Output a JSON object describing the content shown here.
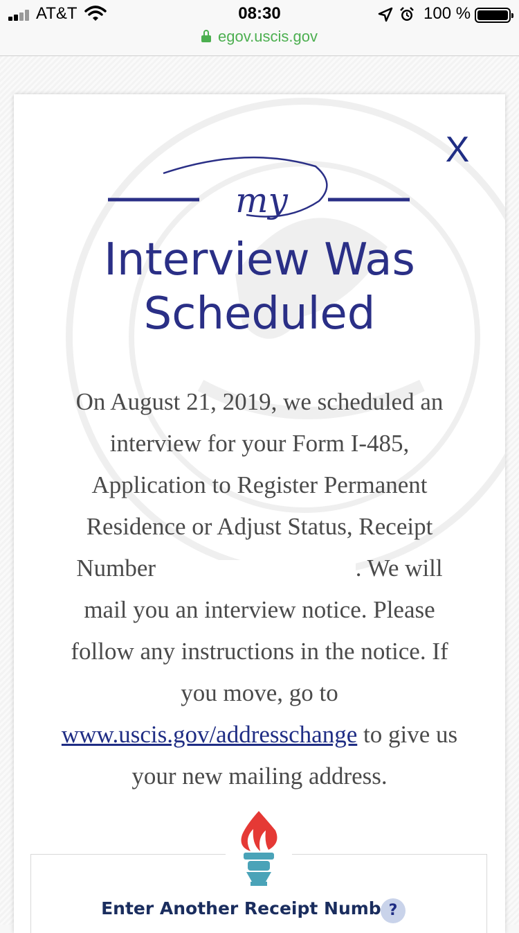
{
  "status_bar": {
    "carrier": "AT&T",
    "time": "08:30",
    "battery_percent": "100 %",
    "url": "egov.uscis.gov",
    "icons": [
      "signal-icon",
      "wifi-icon",
      "location-icon",
      "alarm-icon",
      "battery-icon",
      "lock-icon"
    ]
  },
  "card": {
    "close_label": "X",
    "logo_text": "my",
    "title": "Interview Was Scheduled",
    "message": {
      "part1": "On August 21, 2019, we scheduled an interview for your Form I-485, Application to Register Permanent Residence or Adjust Status, Receipt Number",
      "part2": ". We will mail you an interview notice. Please follow any instructions in the notice. If you move, go to",
      "link_text": "www.uscis.gov/addresschange",
      "part3": "to give us your new mailing address."
    },
    "receipt_label": "Enter Another Receipt Number",
    "help_label": "?"
  },
  "colors": {
    "title_navy": "#2a2f86",
    "url_green": "#4caf50",
    "body_text": "#4a4a4a",
    "torch_flame": "#e53935",
    "torch_handle": "#4aa3b8"
  }
}
